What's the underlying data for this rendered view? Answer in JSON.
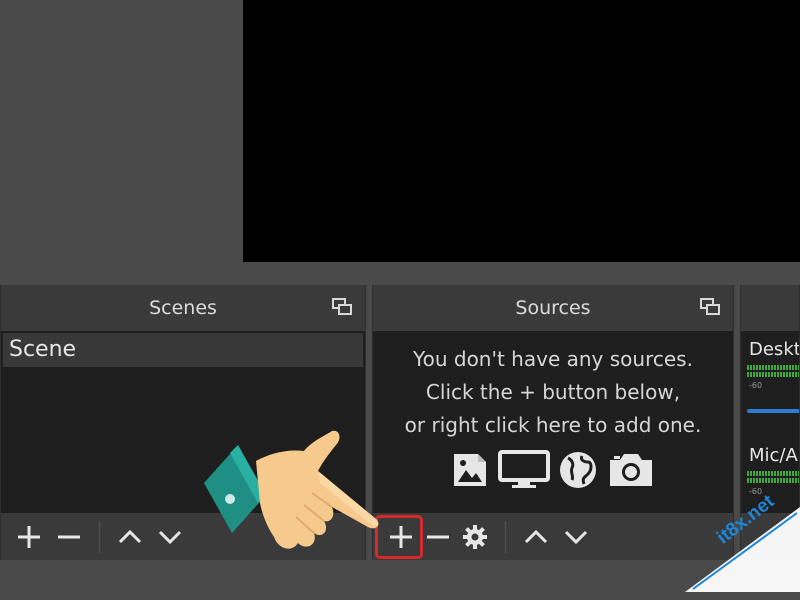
{
  "scenes": {
    "title": "Scenes",
    "items": [
      {
        "label": "Scene"
      }
    ]
  },
  "sources": {
    "title": "Sources",
    "empty_lines": [
      "You don't have any sources.",
      "Click the + button below,",
      "or right click here to add one."
    ]
  },
  "audio": {
    "channels": [
      {
        "label": "Deskto",
        "db_label": "-60"
      },
      {
        "label": "Mic/A",
        "db_label": "-60"
      }
    ]
  },
  "watermark": {
    "text": "it8x.net"
  },
  "colors": {
    "highlight": "#d62a2a",
    "meter_green": "#3fa83f",
    "volume_blue": "#2d7dd2",
    "watermark_blue": "#1c86d8",
    "hand_skin": "#f6c98c",
    "sleeve": "#1f8f84"
  },
  "icons": {
    "float": "float-dock-icon",
    "add": "plus-icon",
    "remove": "minus-icon",
    "settings": "gear-icon",
    "up": "chevron-up-icon",
    "down": "chevron-down-icon",
    "source_types": [
      "image-icon",
      "monitor-icon",
      "globe-icon",
      "camera-icon"
    ]
  }
}
